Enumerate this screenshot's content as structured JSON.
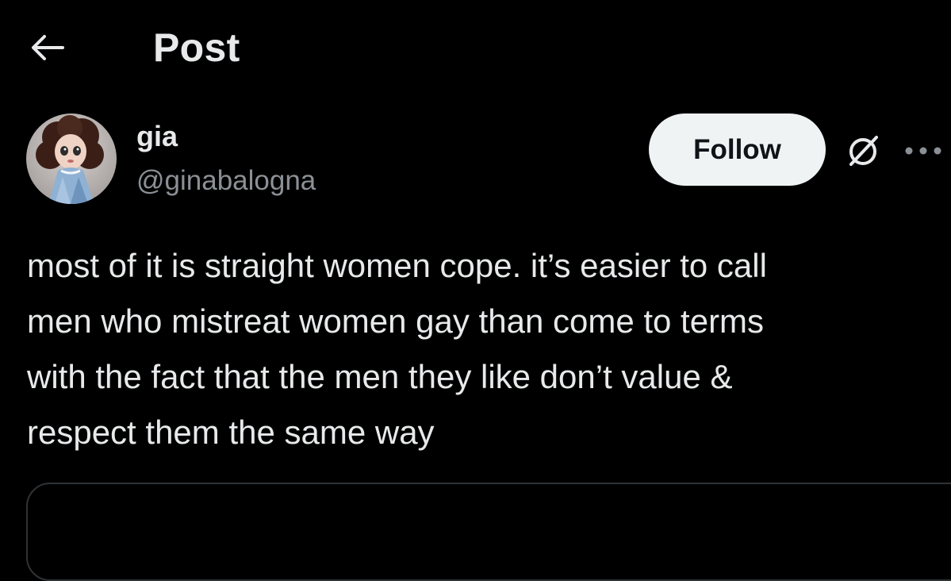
{
  "header": {
    "back_icon": "arrow-left-icon",
    "title": "Post"
  },
  "author": {
    "display_name": "gia",
    "handle": "@ginabalogna",
    "avatar": "doll-avatar-image"
  },
  "actions": {
    "follow_label": "Follow",
    "grok_icon": "grok-slash-circle-icon",
    "more_icon": "more-horizontal-icon"
  },
  "post": {
    "text": "most of it is straight women cope. it’s easier to call\nmen who mistreat women gay than come to terms\nwith the fact that the men they like don’t value &\nrespect them the same way"
  },
  "colors": {
    "background": "#000000",
    "text_primary": "#e7e9ea",
    "text_secondary": "#8b9096",
    "button_bg": "#eff3f4",
    "button_text": "#0f1419",
    "border": "#2f3336"
  }
}
